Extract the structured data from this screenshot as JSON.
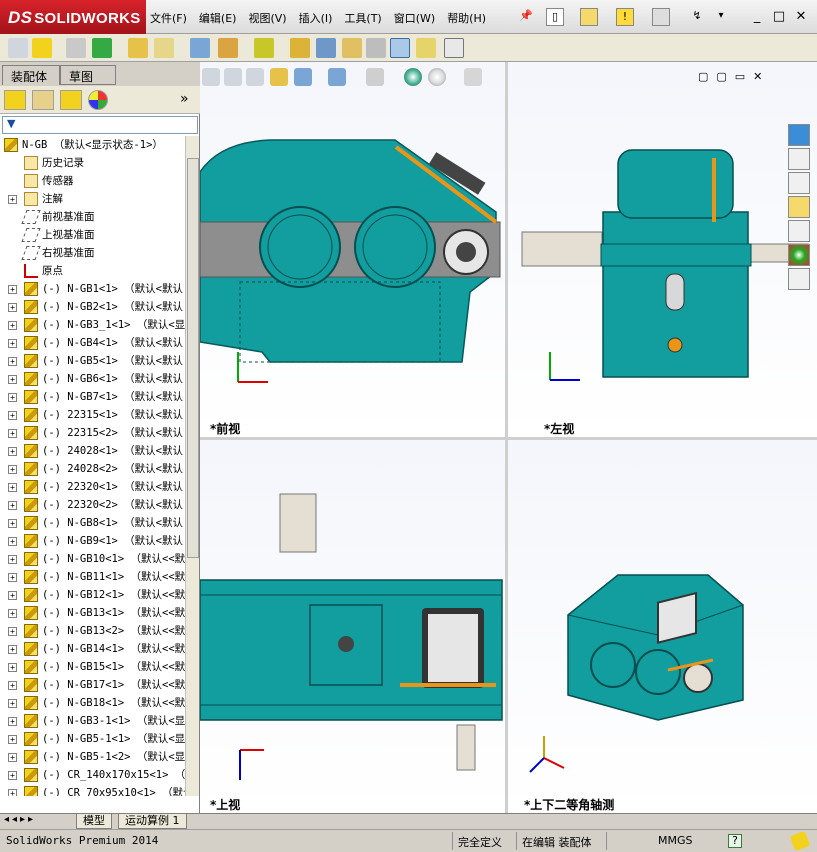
{
  "app": {
    "brand": "SOLIDWORKS",
    "menu": [
      "文件(F)",
      "编辑(E)",
      "视图(V)",
      "插入(I)",
      "工具(T)",
      "窗口(W)",
      "帮助(H)"
    ],
    "window_controls": [
      "_",
      "□",
      "✕"
    ]
  },
  "left_panel": {
    "tabs": [
      "装配体",
      "草图"
    ],
    "collapse_label": "»",
    "root": "N-GB （默认<显示状态-1>）",
    "items": [
      {
        "label": "历史记录",
        "icon": "history-folder-icon",
        "expandable": false
      },
      {
        "label": "传感器",
        "icon": "sensor-folder-icon",
        "expandable": false
      },
      {
        "label": "注解",
        "icon": "annotation-icon",
        "expandable": true
      },
      {
        "label": "前视基准面",
        "icon": "plane-icon",
        "expandable": false
      },
      {
        "label": "上视基准面",
        "icon": "plane-icon",
        "expandable": false
      },
      {
        "label": "右视基准面",
        "icon": "plane-icon",
        "expandable": false
      },
      {
        "label": "原点",
        "icon": "origin-icon",
        "expandable": false
      },
      {
        "label": "(-) N-GB1<1> （默认<默认",
        "icon": "part-icon",
        "expandable": true
      },
      {
        "label": "(-) N-GB2<1> （默认<默认",
        "icon": "part-icon",
        "expandable": true
      },
      {
        "label": "(-) N-GB3_1<1> （默认<显",
        "icon": "part-icon",
        "expandable": true
      },
      {
        "label": "(-) N-GB4<1> （默认<默认",
        "icon": "part-icon",
        "expandable": true
      },
      {
        "label": "(-) N-GB5<1> （默认<默认",
        "icon": "part-icon",
        "expandable": true
      },
      {
        "label": "(-) N-GB6<1> （默认<默认",
        "icon": "part-icon",
        "expandable": true
      },
      {
        "label": "(-) N-GB7<1> （默认<默认",
        "icon": "part-icon",
        "expandable": true
      },
      {
        "label": "(-) 22315<1> （默认<默认",
        "icon": "part-icon",
        "expandable": true
      },
      {
        "label": "(-) 22315<2> （默认<默认",
        "icon": "part-icon",
        "expandable": true
      },
      {
        "label": "(-) 24028<1> （默认<默认",
        "icon": "part-icon",
        "expandable": true
      },
      {
        "label": "(-) 24028<2> （默认<默认",
        "icon": "part-icon",
        "expandable": true
      },
      {
        "label": "(-) 22320<1> （默认<默认",
        "icon": "part-icon",
        "expandable": true
      },
      {
        "label": "(-) 22320<2> （默认<默认",
        "icon": "part-icon",
        "expandable": true
      },
      {
        "label": "(-) N-GB8<1> （默认<默认",
        "icon": "part-icon",
        "expandable": true
      },
      {
        "label": "(-) N-GB9<1> （默认<默认",
        "icon": "part-icon",
        "expandable": true
      },
      {
        "label": "(-) N-GB10<1> （默认<<默",
        "icon": "part-icon",
        "expandable": true
      },
      {
        "label": "(-) N-GB11<1> （默认<<默",
        "icon": "part-icon",
        "expandable": true
      },
      {
        "label": "(-) N-GB12<1> （默认<<默",
        "icon": "part-icon",
        "expandable": true
      },
      {
        "label": "(-) N-GB13<1> （默认<<默",
        "icon": "part-icon",
        "expandable": true
      },
      {
        "label": "(-) N-GB13<2> （默认<<默",
        "icon": "part-icon",
        "expandable": true
      },
      {
        "label": "(-) N-GB14<1> （默认<<默",
        "icon": "part-icon",
        "expandable": true
      },
      {
        "label": "(-) N-GB15<1> （默认<<默",
        "icon": "part-icon",
        "expandable": true
      },
      {
        "label": "(-) N-GB17<1> （默认<<默",
        "icon": "part-icon",
        "expandable": true
      },
      {
        "label": "(-) N-GB18<1> （默认<<默",
        "icon": "part-icon",
        "expandable": true
      },
      {
        "label": "(-) N-GB3-1<1> （默认<显",
        "icon": "part-icon",
        "expandable": true
      },
      {
        "label": "(-) N-GB5-1<1> （默认<显",
        "icon": "part-icon",
        "expandable": true
      },
      {
        "label": "(-) N-GB5-1<2> （默认<显",
        "icon": "part-icon",
        "expandable": true
      },
      {
        "label": "(-) CR_140x170x15<1> （显",
        "icon": "part-icon",
        "expandable": true
      },
      {
        "label": "(-) CR_70x95x10<1> （默认",
        "icon": "part-icon",
        "expandable": true
      }
    ]
  },
  "viewports": [
    {
      "name": "front",
      "label": "*前视",
      "axes": [
        "Y",
        "X"
      ]
    },
    {
      "name": "left",
      "label": "*左视",
      "axes": [
        "Y",
        "Z"
      ]
    },
    {
      "name": "top",
      "label": "*上视",
      "axes": [
        "X",
        "Z"
      ]
    },
    {
      "name": "iso",
      "label": "*上下二等角轴测",
      "axes": [
        "Y",
        "X",
        "Z"
      ]
    }
  ],
  "model_tabs": [
    "模型",
    "运动算例 1"
  ],
  "status": {
    "product": "SolidWorks Premium 2014",
    "definition": "完全定义",
    "editing": "在编辑 装配体",
    "units": "MMGS",
    "help": "?"
  },
  "colors": {
    "gearbox_teal": "#129d9e",
    "gearbox_dark": "#0a6e70",
    "gearbox_grey": "#8e8e8e",
    "accent_orange": "#e8951a",
    "brand_red": "#c8102e"
  }
}
